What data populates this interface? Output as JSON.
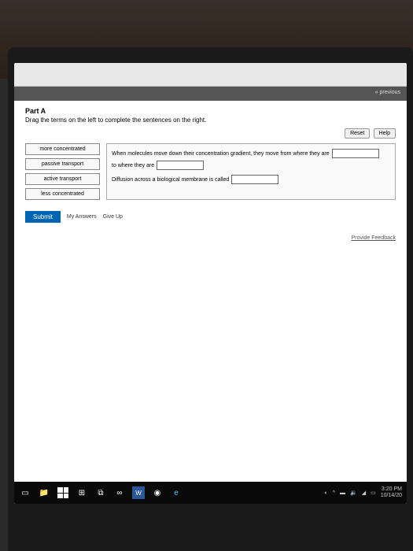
{
  "toolbar": {
    "previous": "« previous"
  },
  "part": {
    "label": "Part A",
    "instructions": "Drag the terms on the left to complete the sentences on the right."
  },
  "buttons": {
    "reset": "Reset",
    "help": "Help"
  },
  "terms": [
    "more concentrated",
    "passive transport",
    "active transport",
    "less concentrated"
  ],
  "sentences": {
    "s1a": "When molecules move down their concentration gradient, they move from where they are",
    "s1b": "to where they are",
    "s2a": "Diffusion across a biological membrane is called"
  },
  "actions": {
    "submit": "Submit",
    "my_answers": "My Answers",
    "give_up": "Give Up"
  },
  "feedback": "Provide Feedback",
  "taskbar": {
    "time": "3:20 PM",
    "date": "10/14/20"
  }
}
